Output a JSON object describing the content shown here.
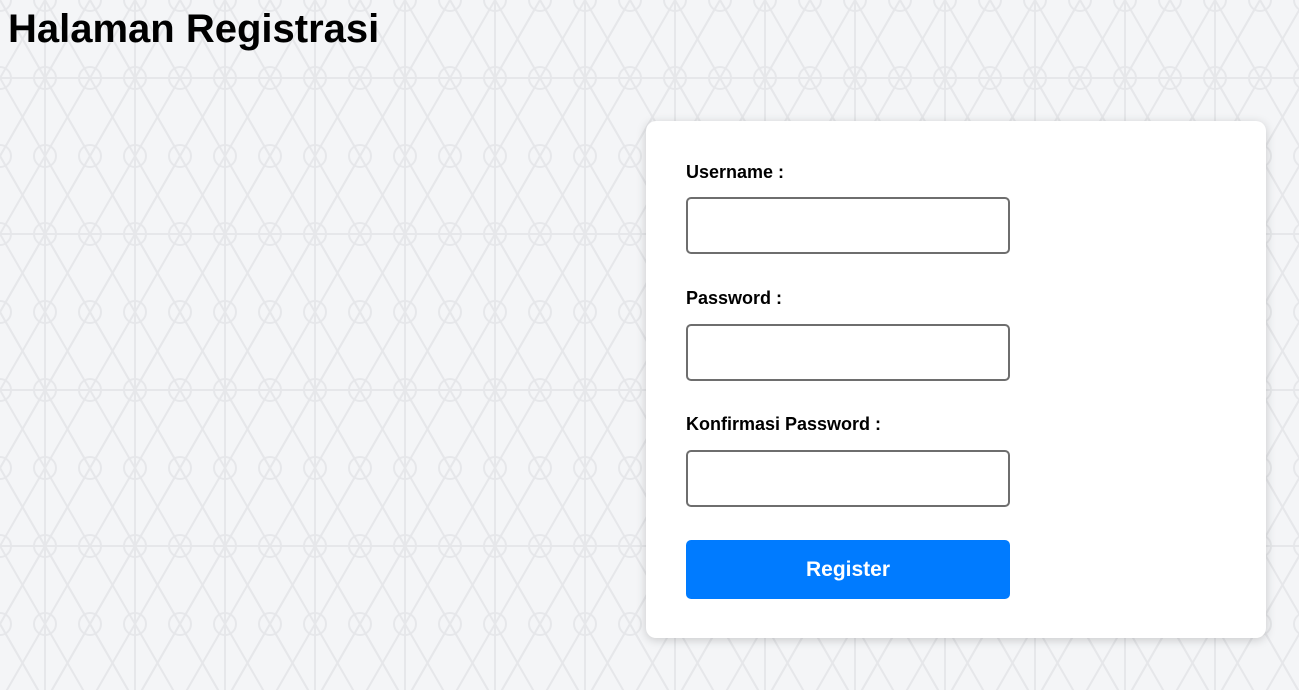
{
  "page": {
    "title": "Halaman Registrasi"
  },
  "form": {
    "username_label": "Username :",
    "username_value": "",
    "password_label": "Password :",
    "password_value": "",
    "confirm_label": "Konfirmasi Password :",
    "confirm_value": "",
    "register_label": "Register"
  },
  "colors": {
    "background": "#f4f5f7",
    "pattern": "#e6e7ea",
    "card": "#ffffff",
    "accent": "#007bff"
  }
}
